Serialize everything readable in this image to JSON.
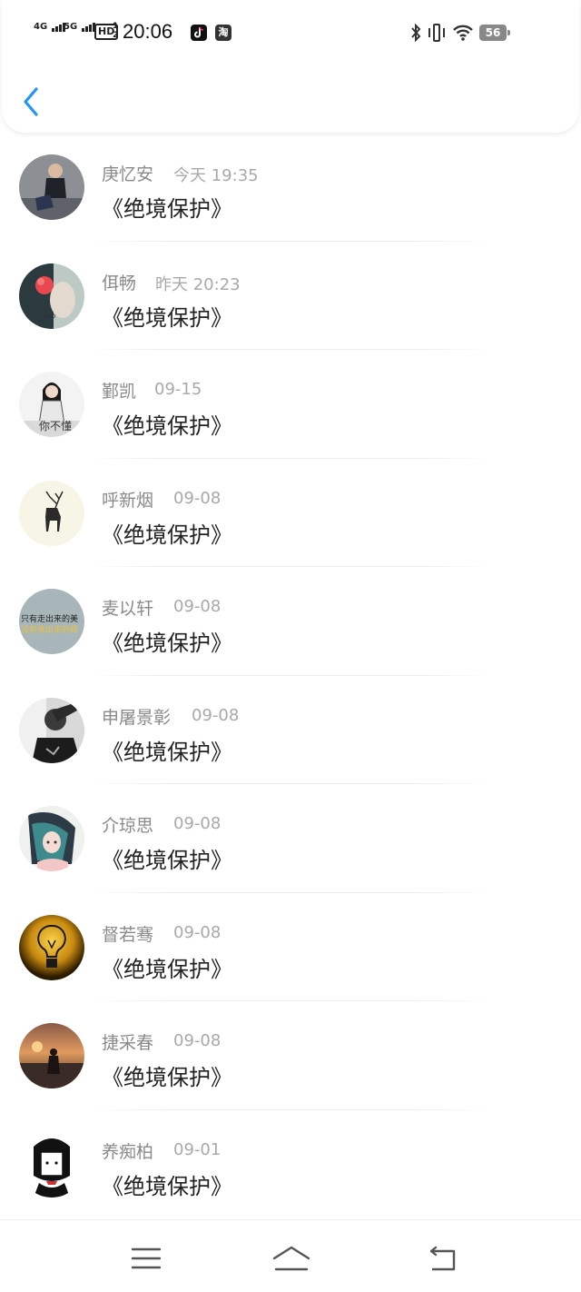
{
  "status_bar": {
    "signal1": "4G",
    "signal2": "5G",
    "hd": "HD",
    "hd_sup": "1\n2",
    "time": "20:06",
    "tiktok_icon": "tiktok-icon",
    "taobao_label": "淘",
    "battery": "56"
  },
  "header": {
    "back_icon": "chevron-left-icon",
    "accent": "#2196f3"
  },
  "items": [
    {
      "name": "庚忆安",
      "time": "今天 19:35",
      "message": "《绝境保护》"
    },
    {
      "name": "佴畅",
      "time": "昨天 20:23",
      "message": "《绝境保护》"
    },
    {
      "name": "鄞凯",
      "time": "09-15",
      "message": "《绝境保护》"
    },
    {
      "name": "呼新烟",
      "time": "09-08",
      "message": "《绝境保护》"
    },
    {
      "name": "麦以轩",
      "time": "09-08",
      "message": "《绝境保护》"
    },
    {
      "name": "申屠景彰",
      "time": "09-08",
      "message": "《绝境保护》"
    },
    {
      "name": "介琼思",
      "time": "09-08",
      "message": "《绝境保护》"
    },
    {
      "name": "督若骞",
      "time": "09-08",
      "message": "《绝境保护》"
    },
    {
      "name": "捷采春",
      "time": "09-08",
      "message": "《绝境保护》"
    },
    {
      "name": "养痴柏",
      "time": "09-01",
      "message": "《绝境保护》"
    }
  ],
  "avatar_texts": {
    "a3": "你不懂",
    "a5_line1": "只有走出来的美",
    "a5_line2": "没有等出来的辉"
  },
  "navbar": {
    "menu_icon": "menu-icon",
    "home_icon": "home-icon",
    "back_icon": "back-arrow-icon"
  }
}
